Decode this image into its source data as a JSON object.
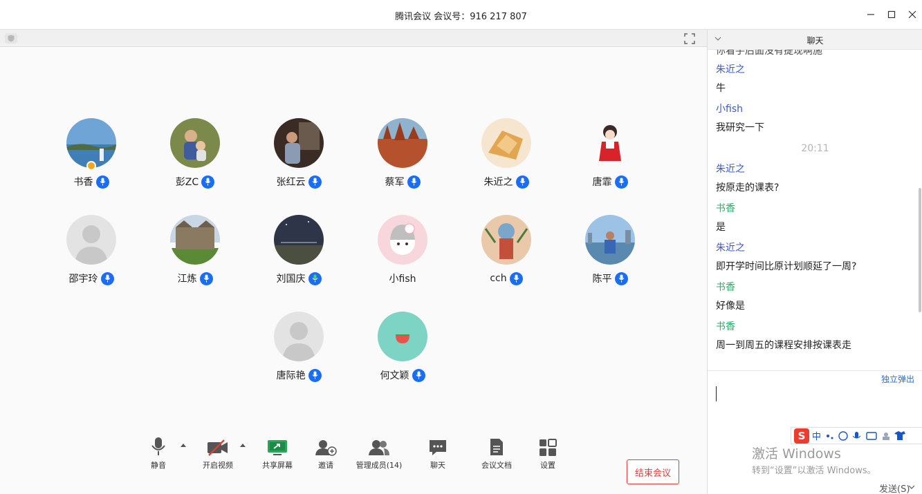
{
  "window": {
    "title": "腾讯会议 会议号：916 217 807"
  },
  "participants": [
    {
      "name": "书香",
      "avatar": "lake-photo",
      "host": true,
      "mic": "on"
    },
    {
      "name": "彭ZC",
      "avatar": "family-photo",
      "mic": "on"
    },
    {
      "name": "张红云",
      "avatar": "child-photo",
      "mic": "on"
    },
    {
      "name": "蔡军",
      "avatar": "autumn-trees-photo",
      "mic": "on"
    },
    {
      "name": "朱近之",
      "avatar": "food-photo",
      "mic": "on"
    },
    {
      "name": "唐霏",
      "avatar": "anime-girl-drawing",
      "mic": "on"
    },
    {
      "name": "邵宇玲",
      "avatar": "default-silhouette",
      "mic": "on"
    },
    {
      "name": "江炼",
      "avatar": "college-building-photo",
      "mic": "on"
    },
    {
      "name": "刘国庆",
      "avatar": "night-sky-photo",
      "mic": "speaking"
    },
    {
      "name": "小fish",
      "avatar": "cartoon-girl-drawing",
      "mic": "none"
    },
    {
      "name": "cch",
      "avatar": "manga-character-drawing",
      "mic": "on"
    },
    {
      "name": "陈平",
      "avatar": "man-by-water-photo",
      "mic": "on"
    },
    {
      "name": "唐际艳",
      "avatar": "default-silhouette",
      "mic": "on"
    },
    {
      "name": "何文颖",
      "avatar": "teal-watermelon-icon",
      "mic": "on"
    }
  ],
  "toolbar": {
    "mute": "静音",
    "video": "开启视频",
    "share": "共享屏幕",
    "invite": "邀请",
    "members": "管理成员(14)",
    "chat": "聊天",
    "docs": "会议文档",
    "settings": "设置",
    "end": "结束会议"
  },
  "chat": {
    "title": "聊天",
    "cut_text": "你看手后面没有提现啊施",
    "messages": [
      {
        "sender": "朱近之",
        "text": "牛",
        "color": "#3b58c9"
      },
      {
        "sender": "小fish",
        "text": "我研究一下",
        "color": "#3b58c9"
      },
      {
        "time": "20:11"
      },
      {
        "sender": "朱近之",
        "text": "按原走的课表?",
        "color": "#3b58c9"
      },
      {
        "sender": "书香",
        "text": "是",
        "color": "#24b06a"
      },
      {
        "sender": "朱近之",
        "text": "即开学时间比原计划顺延了一周?",
        "color": "#3b58c9"
      },
      {
        "sender": "书香",
        "text": "好像是",
        "color": "#24b06a"
      },
      {
        "sender": "书香",
        "text": "周一到周五的课程安排按课表走",
        "color": "#24b06a"
      }
    ],
    "popout": "独立弹出",
    "send": "发送(S)",
    "ime_lang": "中",
    "ime_logo": "S"
  },
  "watermark": {
    "line1": "激活 Windows",
    "line2": "转到“设置”以激活 Windows。"
  },
  "colors": {
    "accent": "#1a6ef5",
    "end": "#e23b3b",
    "self": "#24b06a",
    "other": "#3b58c9"
  }
}
